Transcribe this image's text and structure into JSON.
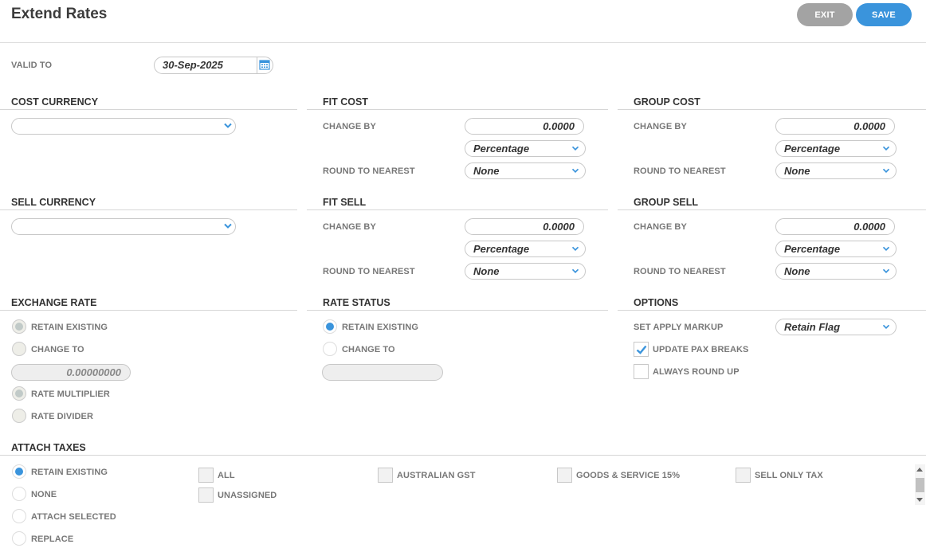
{
  "header": {
    "title": "Extend Rates",
    "exit_label": "EXIT",
    "save_label": "SAVE"
  },
  "valid_to": {
    "label": "VALID TO",
    "value": "30-Sep-2025"
  },
  "cost_currency": {
    "heading": "COST CURRENCY",
    "value": ""
  },
  "sell_currency": {
    "heading": "SELL CURRENCY",
    "value": ""
  },
  "fit_cost": {
    "heading": "FIT COST",
    "change_by_label": "CHANGE BY",
    "change_by_value": "0.0000",
    "mode": "Percentage",
    "round_label": "ROUND TO NEAREST",
    "round_value": "None"
  },
  "group_cost": {
    "heading": "GROUP COST",
    "change_by_label": "CHANGE BY",
    "change_by_value": "0.0000",
    "mode": "Percentage",
    "round_label": "ROUND TO NEAREST",
    "round_value": "None"
  },
  "fit_sell": {
    "heading": "FIT SELL",
    "change_by_label": "CHANGE BY",
    "change_by_value": "0.0000",
    "mode": "Percentage",
    "round_label": "ROUND TO NEAREST",
    "round_value": "None"
  },
  "group_sell": {
    "heading": "GROUP SELL",
    "change_by_label": "CHANGE BY",
    "change_by_value": "0.0000",
    "mode": "Percentage",
    "round_label": "ROUND TO NEAREST",
    "round_value": "None"
  },
  "exchange_rate": {
    "heading": "EXCHANGE RATE",
    "retain_label": "RETAIN EXISTING",
    "change_label": "CHANGE TO",
    "change_value": "0.00000000",
    "multiplier_label": "RATE MULTIPLIER",
    "divider_label": "RATE DIVIDER"
  },
  "rate_status": {
    "heading": "RATE STATUS",
    "retain_label": "RETAIN EXISTING",
    "change_label": "CHANGE TO",
    "change_value": ""
  },
  "options": {
    "heading": "OPTIONS",
    "markup_label": "SET APPLY MARKUP",
    "markup_value": "Retain Flag",
    "update_pax_label": "UPDATE PAX BREAKS",
    "round_up_label": "ALWAYS ROUND UP"
  },
  "attach_taxes": {
    "heading": "ATTACH TAXES",
    "modes": [
      "RETAIN EXISTING",
      "NONE",
      "ATTACH SELECTED",
      "REPLACE"
    ],
    "taxes": [
      "ALL",
      "UNASSIGNED",
      "AUSTRALIAN GST",
      "GOODS & SERVICE 15%",
      "SELL ONLY TAX"
    ]
  },
  "colors": {
    "accent": "#3a94dc",
    "exit_button": "#a3a3a3"
  }
}
